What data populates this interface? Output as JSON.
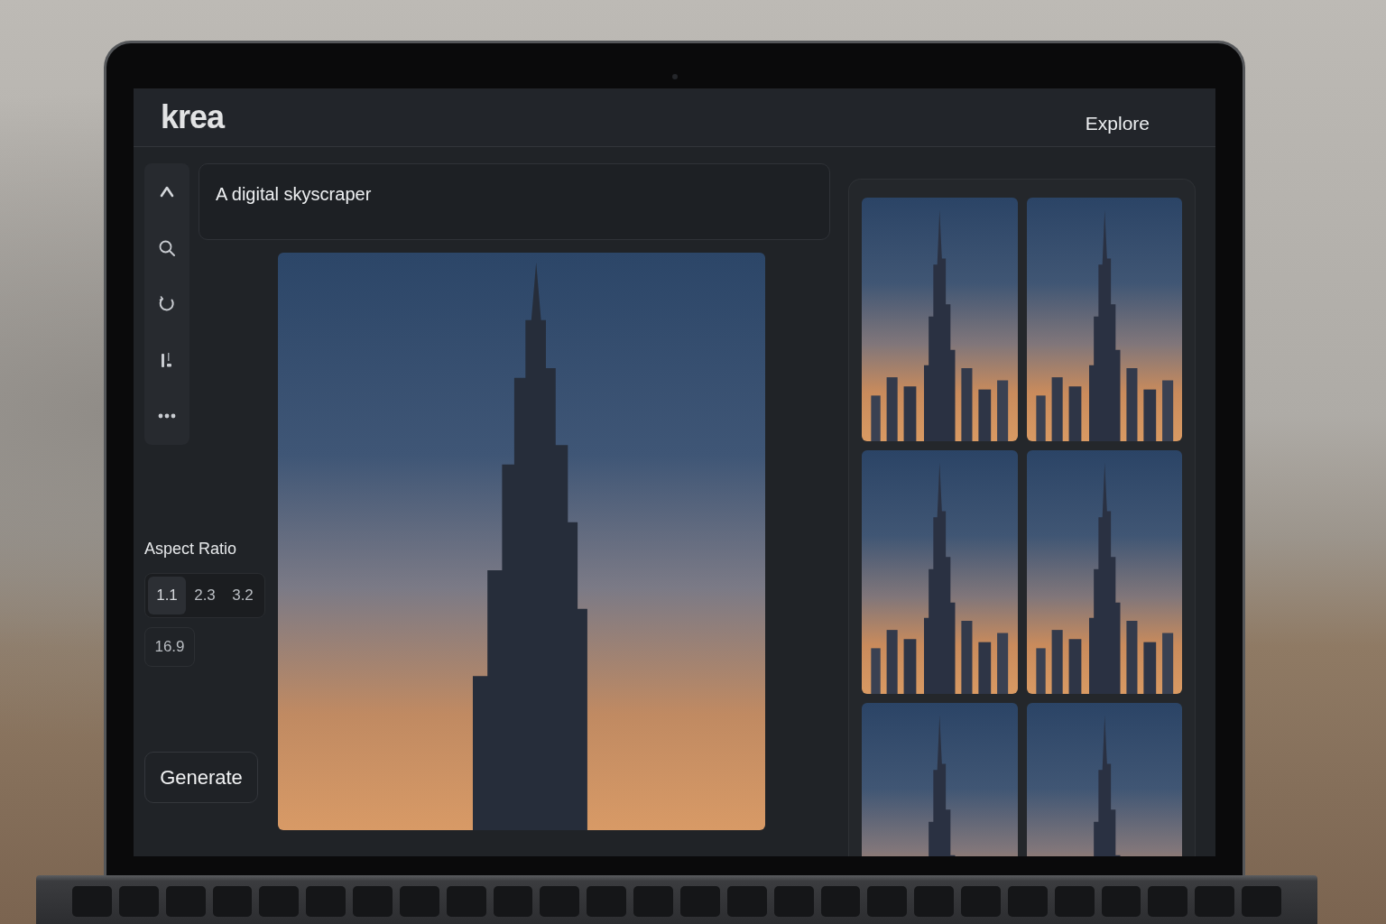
{
  "header": {
    "logo": "krea",
    "nav_link": "Explore"
  },
  "prompt": {
    "value": "A digital skyscraper"
  },
  "aspect_ratio": {
    "label": "Aspect Ratio",
    "options": [
      {
        "label": "1.1",
        "selected": true
      },
      {
        "label": "2.3",
        "selected": false
      },
      {
        "label": "3.2",
        "selected": false
      },
      {
        "label": "16.9",
        "selected": false
      }
    ]
  },
  "generate_button": {
    "label": "Generate"
  }
}
